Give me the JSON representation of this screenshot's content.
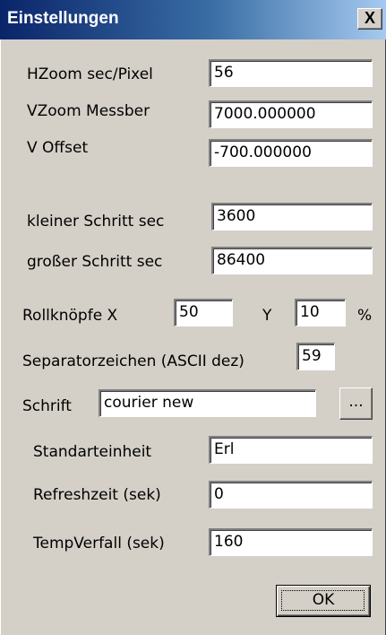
{
  "dialog": {
    "title": "Einstellungen",
    "close_glyph": "X"
  },
  "fields": {
    "hzoom": {
      "label": "HZoom sec/Pixel",
      "value": "56"
    },
    "vzoom": {
      "label": "VZoom Messber",
      "value": "7000.000000"
    },
    "voffset": {
      "label": "V Offset",
      "value": "-700.000000"
    },
    "kleiner": {
      "label": "kleiner Schritt sec",
      "value": "3600"
    },
    "grosser": {
      "label": "großer Schritt sec",
      "value": "86400"
    },
    "rollknoepfe": {
      "label": "Rollknöpfe X",
      "x_value": "50",
      "y_label": "Y",
      "y_value": "10",
      "unit": "%"
    },
    "separator": {
      "label": "Separatorzeichen (ASCII dez)",
      "value": "59"
    },
    "schrift": {
      "label": "Schrift",
      "value": "courier new",
      "browse_label": "..."
    },
    "standard": {
      "label": "Standarteinheit",
      "value": "Erl"
    },
    "refresh": {
      "label": "Refreshzeit (sek)",
      "value": "0"
    },
    "temp": {
      "label": "TempVerfall (sek)",
      "value": "160"
    }
  },
  "buttons": {
    "ok_label": "OK"
  }
}
